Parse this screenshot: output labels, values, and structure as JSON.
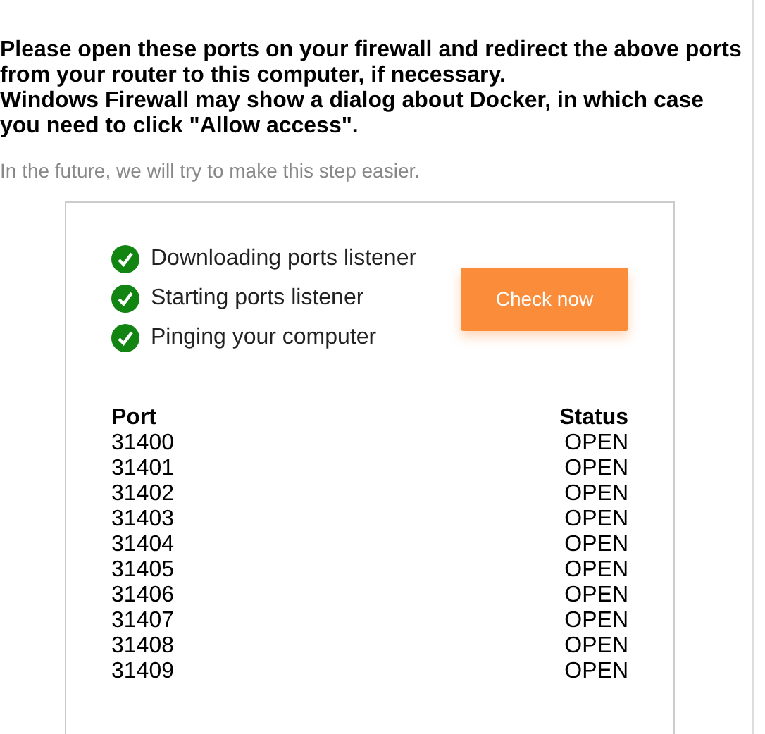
{
  "instructions": "Please open these ports on your firewall and redirect the above ports from your router to this computer, if necessary.\nWindows Firewall may show a dialog about Docker, in which case you need to click \"Allow access\".",
  "note": "In the future, we will try to make this step easier.",
  "steps": [
    {
      "label": "Downloading ports listener",
      "done": true
    },
    {
      "label": "Starting ports listener",
      "done": true
    },
    {
      "label": "Pinging your computer",
      "done": true
    }
  ],
  "check_button": "Check now",
  "table": {
    "columns": [
      "Port",
      "Status"
    ],
    "rows": [
      [
        "31400",
        "OPEN"
      ],
      [
        "31401",
        "OPEN"
      ],
      [
        "31402",
        "OPEN"
      ],
      [
        "31403",
        "OPEN"
      ],
      [
        "31404",
        "OPEN"
      ],
      [
        "31405",
        "OPEN"
      ],
      [
        "31406",
        "OPEN"
      ],
      [
        "31407",
        "OPEN"
      ],
      [
        "31408",
        "OPEN"
      ],
      [
        "31409",
        "OPEN"
      ]
    ]
  }
}
